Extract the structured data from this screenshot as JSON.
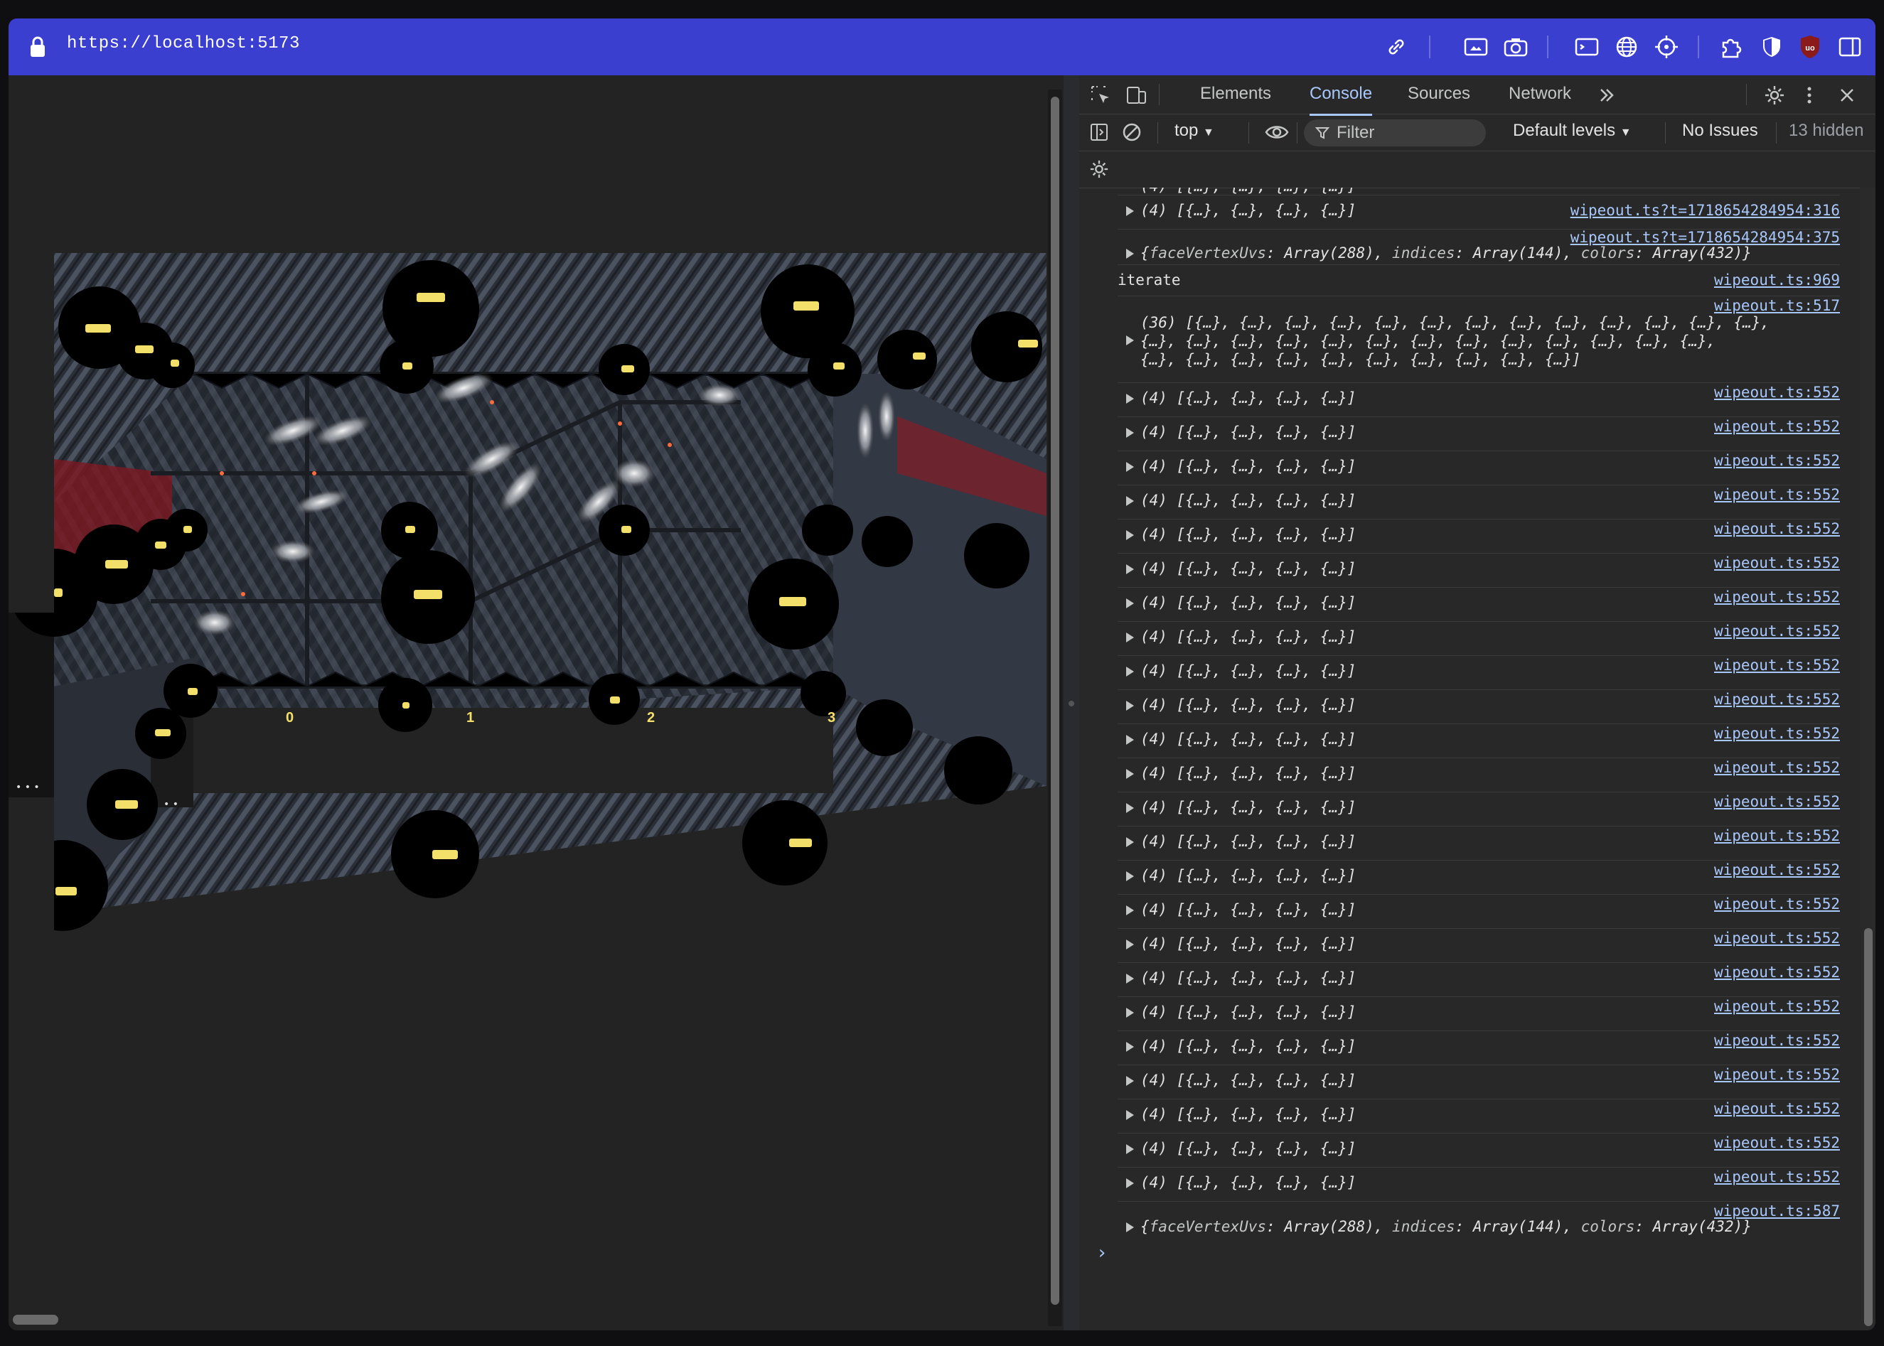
{
  "browser": {
    "url": "https://localhost:5173"
  },
  "viewport": {
    "track_labels": [
      "0",
      "1",
      "2",
      "3"
    ],
    "ellipsis_left": "• • •",
    "ellipsis_right": "• •"
  },
  "devtools": {
    "tabs": [
      "Elements",
      "Console",
      "Sources",
      "Network"
    ],
    "active_tab": "Console",
    "more_tabs_icon": "chevrons-right-icon",
    "context": "top",
    "filter_placeholder": "Filter",
    "levels": "Default levels",
    "issues": "No Issues",
    "hidden": "13 hidden"
  },
  "console": {
    "partial_top": "(4) [{…}, {…}, {…}, {…}]",
    "entries": [
      {
        "kind": "obj",
        "text": "(4) [{…}, {…}, {…}, {…}]",
        "source": "wipeout.ts?t=1718654284954:316"
      },
      {
        "kind": "obj2",
        "source": "wipeout.ts?t=1718654284954:375",
        "parts": [
          "{",
          "faceVertexUvs",
          ": Array(288), ",
          "indices",
          ": Array(144), ",
          "colors",
          ": Array(432)}"
        ]
      },
      {
        "kind": "plain",
        "text": "iterate",
        "source": "wipeout.ts:969"
      },
      {
        "kind": "multi",
        "source": "wipeout.ts:517",
        "lines": [
          "(36) [{…}, {…}, {…}, {…}, {…}, {…}, {…}, {…}, {…}, {…}, {…}, {…}, {…},",
          "{…}, {…}, {…}, {…}, {…}, {…}, {…}, {…}, {…}, {…}, {…}, {…}, {…},",
          "{…}, {…}, {…}, {…}, {…}, {…}, {…}, {…}, {…}, {…}]"
        ]
      }
    ],
    "repeat_text": "(4) [{…}, {…}, {…}, {…}]",
    "repeat_source": "wipeout.ts:552",
    "repeat_count": 24,
    "last": {
      "source": "wipeout.ts:587",
      "parts": [
        "{",
        "faceVertexUvs",
        ": Array(288), ",
        "indices",
        ": Array(144), ",
        "colors",
        ": Array(432)}"
      ]
    },
    "prompt": "›"
  }
}
